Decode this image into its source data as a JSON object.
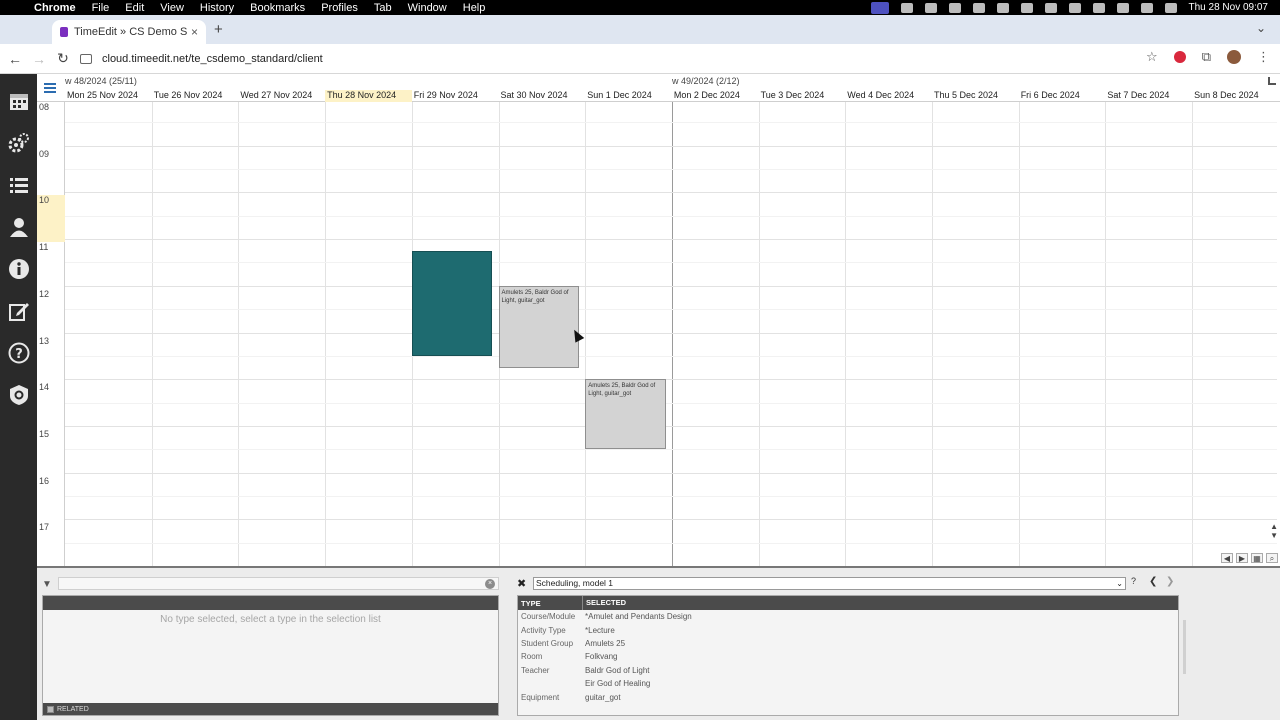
{
  "menubar": {
    "items": [
      "Chrome",
      "File",
      "Edit",
      "View",
      "History",
      "Bookmarks",
      "Profiles",
      "Tab",
      "Window",
      "Help"
    ],
    "clock": "Thu 28 Nov  09:07"
  },
  "browser": {
    "tab_title": "TimeEdit » CS Demo Standar",
    "url": "cloud.timeedit.net/te_csdemo_standard/client"
  },
  "calendar": {
    "weeks": [
      {
        "label": "w 48/2024 (25/11)"
      },
      {
        "label": "w 49/2024 (2/12)"
      }
    ],
    "days": [
      "Mon 25 Nov 2024",
      "Tue 26 Nov 2024",
      "Wed 27 Nov 2024",
      "Thu 28 Nov 2024",
      "Fri 29 Nov 2024",
      "Sat 30 Nov 2024",
      "Sun 1 Dec 2024",
      "Mon 2 Dec 2024",
      "Tue 3 Dec 2024",
      "Wed 4 Dec 2024",
      "Thu 5 Dec 2024",
      "Fri 6 Dec 2024",
      "Sat 7 Dec 2024",
      "Sun 8 Dec 2024"
    ],
    "today_index": 3,
    "hours": [
      "08",
      "09",
      "10",
      "11",
      "12",
      "13",
      "14",
      "15",
      "16",
      "17"
    ],
    "current_hour_index": 2,
    "bookings": [
      {
        "day": 4,
        "start": 11.25,
        "end": 13.5,
        "color": "#1e6b70",
        "text": ""
      },
      {
        "day": 5,
        "start": 12.0,
        "end": 13.75,
        "color": "#d3d3d3",
        "text": "Amulets 25, Baldr God of Light, guitar_got"
      },
      {
        "day": 6,
        "start": 14.0,
        "end": 15.5,
        "color": "#d3d3d3",
        "text": "Amulets 25, Baldr God of Light, guitar_got"
      }
    ]
  },
  "bottom": {
    "empty_message": "No type selected, select a type in the selection list",
    "related_label": "RELATED",
    "scheduling_model": "Scheduling, model 1",
    "help_label": "?",
    "table_headers": {
      "type": "TYPE",
      "selected": "SELECTED"
    },
    "rows": [
      {
        "type": "Course/Module",
        "value": "*Amulet and Pendants Design"
      },
      {
        "type": "Activity Type",
        "value": "*Lecture"
      },
      {
        "type": "Student Group",
        "value": "Amulets 25"
      },
      {
        "type": "Room",
        "value": "Folkvang"
      },
      {
        "type": "Teacher",
        "value": "Baldr God of Light"
      },
      {
        "type": "",
        "value": "Eir God of Healing"
      },
      {
        "type": "Equipment",
        "value": "guitar_got"
      }
    ]
  },
  "icons": {
    "sidebar": [
      "calendar-icon",
      "settings-icon",
      "list-icon",
      "user-icon",
      "info-icon",
      "edit-icon",
      "help-icon",
      "shield-icon"
    ]
  },
  "colors": {
    "accent": "#2b6cb0",
    "today": "#fdf2c7",
    "booking_teal": "#1e6b70",
    "booking_grey": "#d3d3d3"
  }
}
